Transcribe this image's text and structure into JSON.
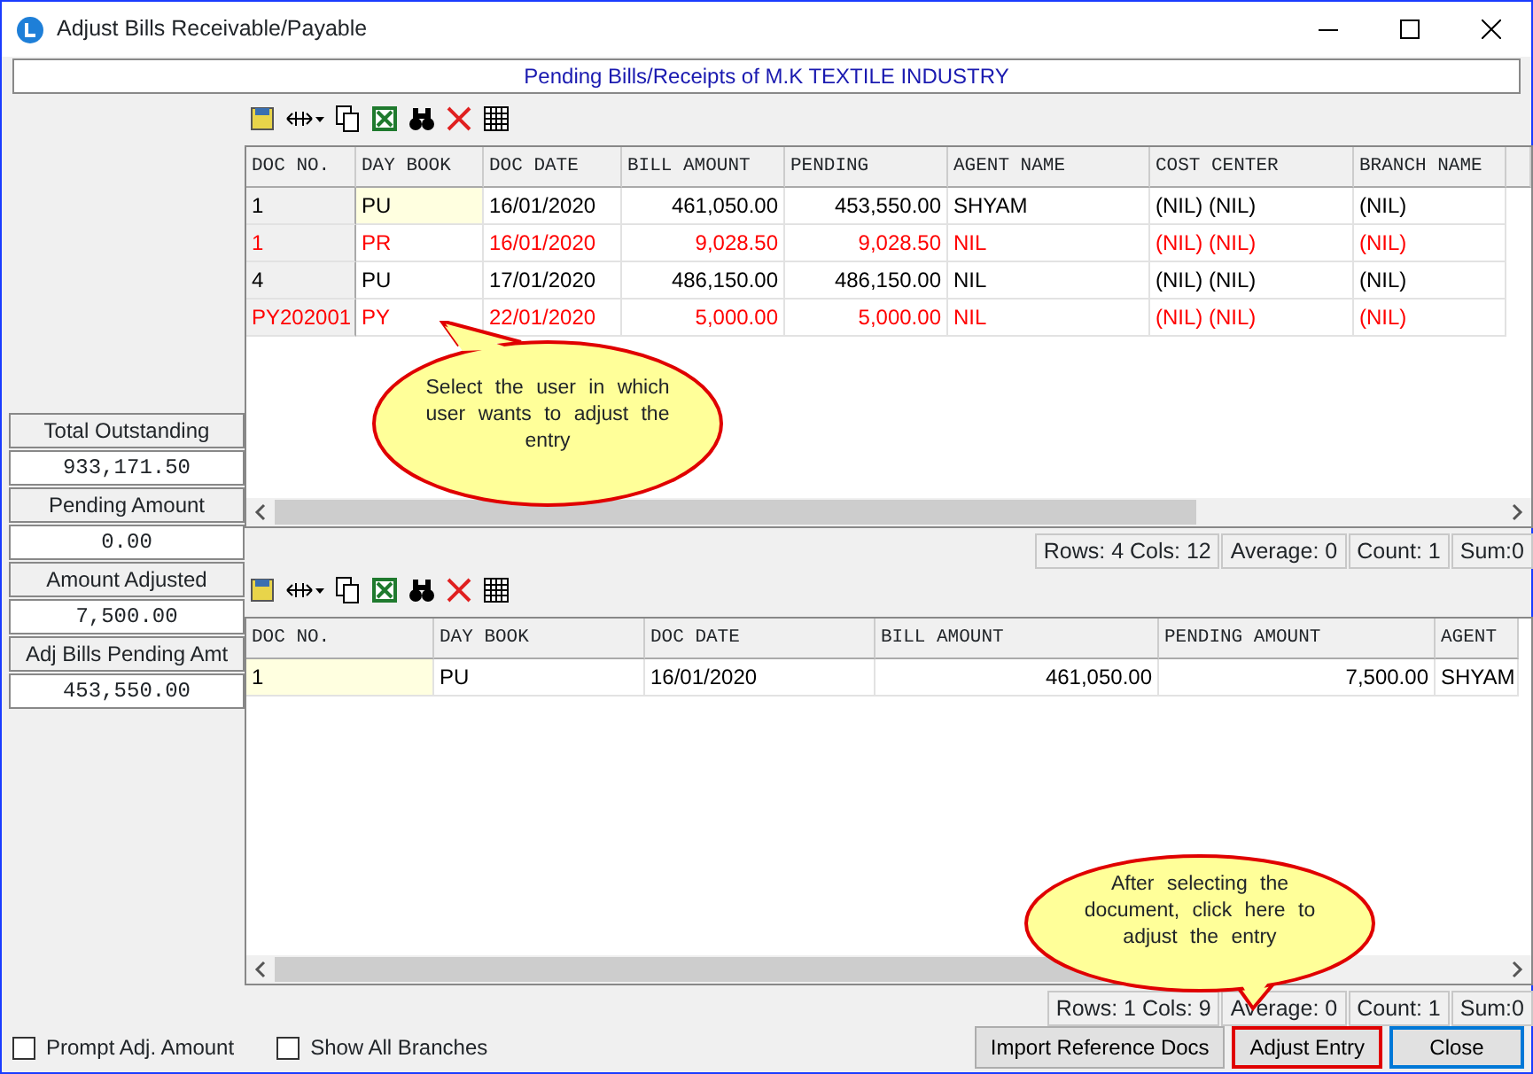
{
  "window": {
    "title": "Adjust Bills Receivable/Payable"
  },
  "header": "Pending Bills/Receipts of M.K TEXTILE INDUSTRY",
  "summary": [
    {
      "label": "Total Outstanding",
      "value": "933,171.50"
    },
    {
      "label": "Pending Amount",
      "value": "0.00"
    },
    {
      "label": "Amount Adjusted",
      "value": "7,500.00"
    },
    {
      "label": "Adj Bills Pending Amt",
      "value": "453,550.00"
    }
  ],
  "grids": [
    {
      "frozen_first_column": true,
      "columns": [
        {
          "label": "DOC NO.",
          "kind": "text",
          "cursor": false
        },
        {
          "label": "DAY BOOK",
          "kind": "text",
          "cursor": true
        },
        {
          "label": "DOC DATE",
          "kind": "text",
          "cursor": false
        },
        {
          "label": "BILL AMOUNT",
          "kind": "amount",
          "cursor": false
        },
        {
          "label": "PENDING",
          "kind": "amount",
          "cursor": false
        },
        {
          "label": "AGENT NAME",
          "kind": "text",
          "cursor": false
        },
        {
          "label": "COST CENTER",
          "kind": "text",
          "cursor": false
        },
        {
          "label": "BRANCH NAME",
          "kind": "text",
          "cursor": false
        }
      ],
      "rows": [
        {
          "selected": true,
          "color": "#000000",
          "cells": [
            "1",
            "PU",
            "16/01/2020",
            "461,050.00",
            "453,550.00",
            "SHYAM",
            "(NIL) (NIL)",
            "(NIL)"
          ]
        },
        {
          "selected": false,
          "color": "#ff0000",
          "cells": [
            "1",
            "PR",
            "16/01/2020",
            "9,028.50",
            "9,028.50",
            "NIL",
            "(NIL) (NIL)",
            "(NIL)"
          ]
        },
        {
          "selected": false,
          "color": "#000000",
          "cells": [
            "4",
            "PU",
            "17/01/2020",
            "486,150.00",
            "486,150.00",
            "NIL",
            "(NIL) (NIL)",
            "(NIL)"
          ]
        },
        {
          "selected": false,
          "color": "#ff0000",
          "cells": [
            "PY202001",
            "PY",
            "22/01/2020",
            "5,000.00",
            "5,000.00",
            "NIL",
            "(NIL) (NIL)",
            "(NIL)"
          ]
        }
      ],
      "status": [
        "Rows: 4  Cols: 12",
        "Average: 0",
        "Count: 1",
        "Sum:0"
      ]
    },
    {
      "frozen_first_column": false,
      "columns": [
        {
          "label": "DOC NO.",
          "kind": "text",
          "cursor": true
        },
        {
          "label": "DAY BOOK",
          "kind": "text",
          "cursor": false
        },
        {
          "label": "DOC DATE",
          "kind": "text",
          "cursor": false
        },
        {
          "label": "BILL AMOUNT",
          "kind": "amount",
          "cursor": false
        },
        {
          "label": "PENDING AMOUNT",
          "kind": "amount",
          "cursor": false
        },
        {
          "label": "AGENT",
          "kind": "text",
          "cursor": false
        }
      ],
      "rows": [
        {
          "selected": true,
          "color": "#000000",
          "cells": [
            "1",
            "PU",
            "16/01/2020",
            "461,050.00",
            "7,500.00",
            "SHYAM"
          ]
        }
      ],
      "status": [
        "Rows: 1  Cols: 9",
        "Average: 0",
        "Count: 1",
        "Sum:0"
      ]
    }
  ],
  "callouts": [
    "Select the user in which user wants to adjust the entry",
    "After selecting the document, click here to adjust the entry"
  ],
  "options": [
    {
      "label": "Prompt Adj. Amount",
      "checked": false
    },
    {
      "label": "Show All Branches",
      "checked": false
    }
  ],
  "buttons": [
    {
      "label": "Import Reference Docs",
      "kind": "normal"
    },
    {
      "label": "Adjust Entry",
      "kind": "highlight"
    },
    {
      "label": "Close",
      "kind": "default"
    }
  ]
}
